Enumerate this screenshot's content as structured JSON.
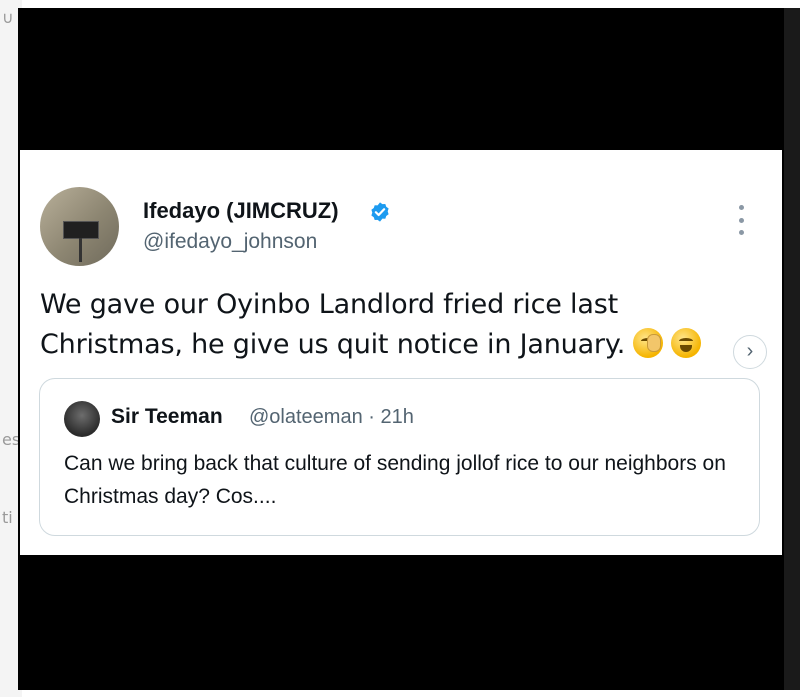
{
  "background": {
    "fragments": [
      "∪",
      "es",
      "ti"
    ]
  },
  "tweet": {
    "author_name": "Ifedayo (JIMCRUZ)",
    "author_handle": "@ifedayo_johnson",
    "text": "We gave our Oyinbo Landlord fried rice last Christmas, he give us quit notice in January.",
    "emojis": [
      "face-with-hand-over-eye",
      "tears-of-joy"
    ],
    "verified_color": "#1d9bf0"
  },
  "quote": {
    "author_name": "Sir Teeman",
    "author_handle": "@olateeman",
    "time": "21h",
    "separator": "·",
    "text": "Can we bring back that culture of sending jollof rice to our neighbors on Christmas day? Cos...."
  },
  "nav": {
    "next_icon": "chevron-right-icon"
  }
}
